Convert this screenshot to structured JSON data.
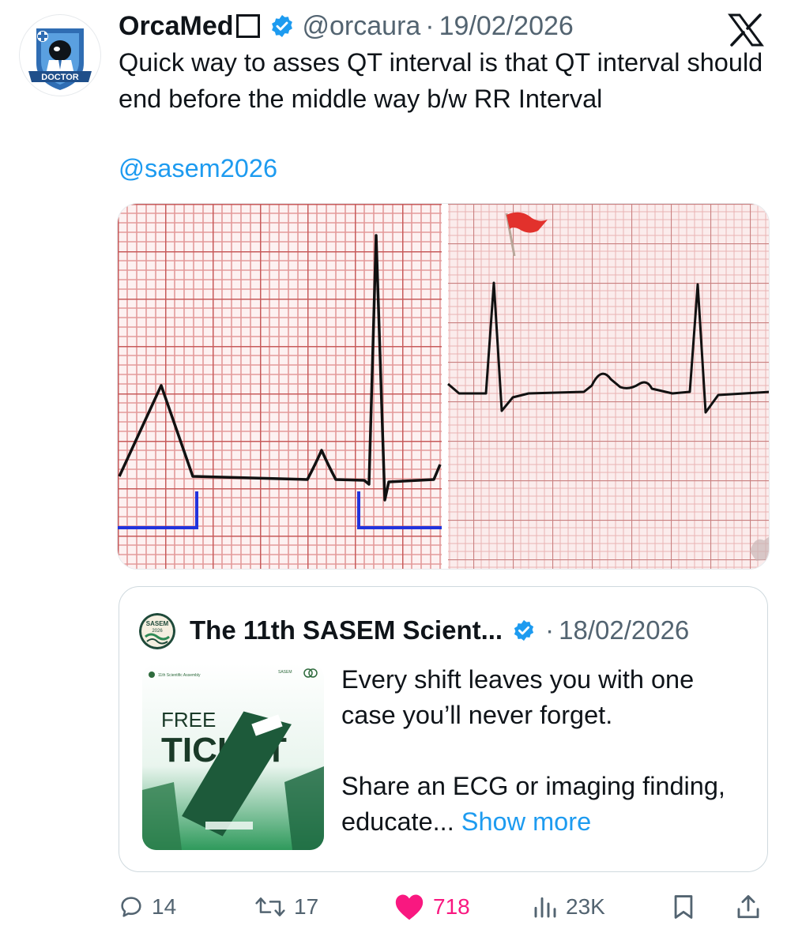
{
  "post": {
    "author_name": "OrcaMed",
    "handle": "@orcaura",
    "separator": "·",
    "date": "19/02/2026",
    "avatar_label": "DOCTOR",
    "text": "Quick way to asses QT interval is that QT interval should end before the middle way b/w RR Interval",
    "mention": "@sasem2026"
  },
  "quote": {
    "author_name": "The 11th SASEM Scient...",
    "separator": "·",
    "date": "18/02/2026",
    "avatar_text_1": "SASEM",
    "avatar_text_2": "2026",
    "thumb_small_1": "11th Scientific Assembly",
    "thumb_small_2": "SASEM",
    "thumb_free": "FREE",
    "thumb_ticket": "TICKET",
    "paragraph1": "Every shift leaves you with one case you’ll never forget.",
    "paragraph2": "Share an ECG or imaging finding, educate...",
    "show_more": "Show more"
  },
  "actions": {
    "replies": "14",
    "reposts": "17",
    "likes": "718",
    "views": "23K"
  },
  "colors": {
    "accent_blue": "#1d9bf0",
    "like_pink": "#f91880",
    "secondary_text": "#536471",
    "ecg_grid": "#d98c8c"
  },
  "icons": [
    "x-logo-icon",
    "verified-badge-icon",
    "reply-icon",
    "repost-icon",
    "like-icon",
    "views-icon",
    "bookmark-icon",
    "share-icon",
    "red-flag-icon"
  ]
}
